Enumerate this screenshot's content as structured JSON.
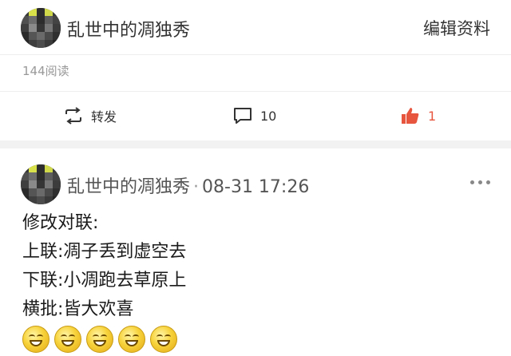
{
  "post_top": {
    "author": "乱世中的凋独秀",
    "edit_label": "编辑资料",
    "reads": "144阅读",
    "actions": {
      "repost_label": "转发",
      "comment_count": "10",
      "like_count": "1"
    }
  },
  "comment": {
    "author": "乱世中的凋独秀",
    "separator": "·",
    "timestamp": "08-31 17:26",
    "lines": [
      "修改对联:",
      "上联:凋子丢到虚空去",
      "下联:小凋跑去草原上",
      "横批:皆大欢喜"
    ],
    "emoji_count": 5
  },
  "colors": {
    "like_accent": "#e8553e",
    "separator_bg": "#f2f2f2",
    "muted_text": "#999999"
  },
  "icons": [
    "avatar-pixelated",
    "repost-icon",
    "comment-icon",
    "thumbs-up-icon",
    "more-icon",
    "grinning-emoji"
  ]
}
